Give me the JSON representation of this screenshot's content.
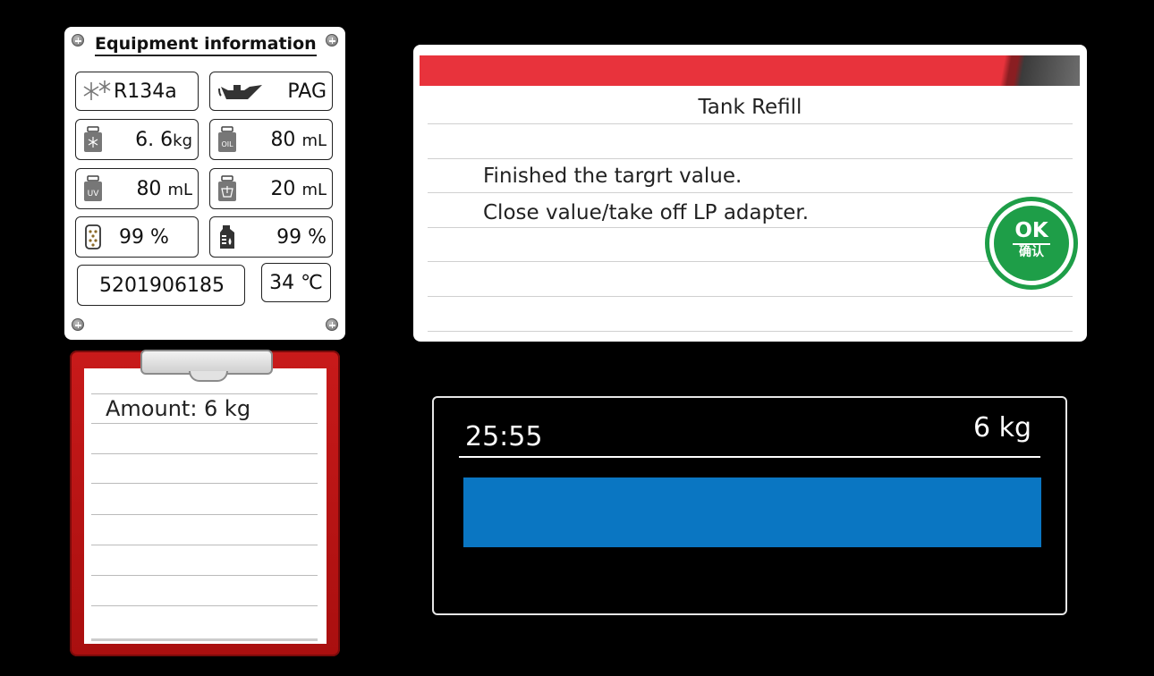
{
  "equipment": {
    "title": "Equipment information",
    "refrigerant": "R134a",
    "oil_type": "PAG",
    "refrigerant_weight": {
      "value": "6. 6",
      "unit": "kg"
    },
    "oil_volume": {
      "value": "80",
      "unit": "mL"
    },
    "uv_volume": {
      "value": "80",
      "unit": "mL"
    },
    "waste_oil_volume": {
      "value": "20",
      "unit": "mL"
    },
    "filter_life": "99 %",
    "bottle_level": "99 %",
    "serial": "5201906185",
    "temperature": "34 ℃",
    "icon_labels": {
      "oil": "OIL",
      "uv": "UV"
    }
  },
  "clipboard": {
    "amount": "Amount: 6 kg"
  },
  "dialog": {
    "title": "Tank Refill",
    "line1": "Finished the targrt value.",
    "line2": "Close value/take off LP adapter.",
    "ok_label": "OK",
    "ok_sublabel": "确认"
  },
  "progress": {
    "time": "25:55",
    "target": "6 kg",
    "fraction": 1.0,
    "fill_color": "#0a76c2"
  },
  "colors": {
    "header_red": "#e8333c",
    "ok_green": "#1e9e48",
    "clipboard_red": "#c81a1a"
  }
}
